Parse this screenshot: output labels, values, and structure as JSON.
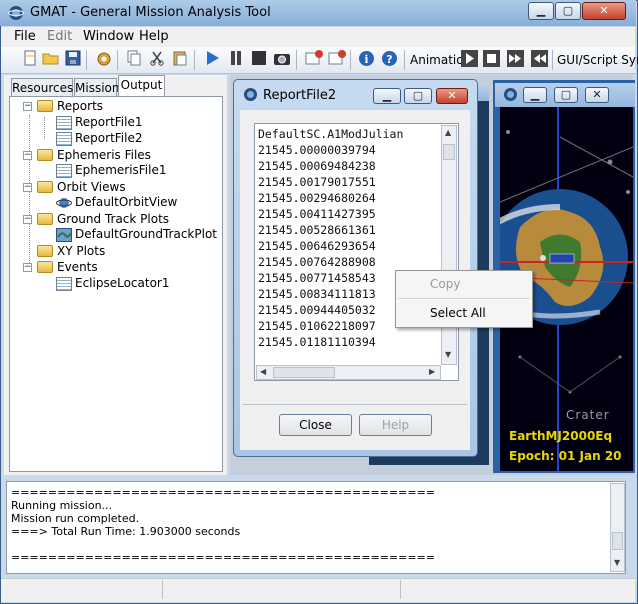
{
  "window": {
    "title": "GMAT - General Mission Analysis Tool"
  },
  "menu": [
    "File",
    "Edit",
    "Window",
    "Help"
  ],
  "toolbar": {
    "animation_label": "Animation",
    "gui_script_label": "GUI/Script Syn"
  },
  "tabs": [
    "Resources",
    "Mission",
    "Output"
  ],
  "tree": {
    "reports": "Reports",
    "report1": "ReportFile1",
    "report2": "ReportFile2",
    "ephemeris": "Ephemeris Files",
    "ephem1": "EphemerisFile1",
    "orbitviews": "Orbit Views",
    "orbit1": "DefaultOrbitView",
    "groundtrack": "Ground Track Plots",
    "ground1": "DefaultGroundTrackPlot",
    "xyplots": "XY Plots",
    "events": "Events",
    "event1": "EclipseLocator1"
  },
  "report_window": {
    "title": "ReportFile2",
    "header": "DefaultSC.A1ModJulian",
    "lines": [
      "21545.00000039794",
      "21545.00069484238",
      "21545.00179017551",
      "21545.00294680264",
      "21545.00411427395",
      "21545.00528661361",
      "21545.00646293654",
      "21545.00764288908",
      "21545.00771458543",
      "21545.00834111813",
      "21545.00944405032",
      "21545.01062218097",
      "21545.01181110394"
    ],
    "close_label": "Close",
    "help_label": "Help"
  },
  "context_menu": {
    "copy": "Copy",
    "select_all": "Select All"
  },
  "graphics": {
    "crater_label": "Crater",
    "frame_label": "EarthMJ2000Eq",
    "epoch_label": "Epoch: 01 Jan 20"
  },
  "messages": {
    "separator": "==============================================",
    "line1": "Running mission...",
    "line2": "Mission run completed.",
    "line3": "===> Total Run Time: 1.903000 seconds",
    "separator2": "=============================================="
  }
}
